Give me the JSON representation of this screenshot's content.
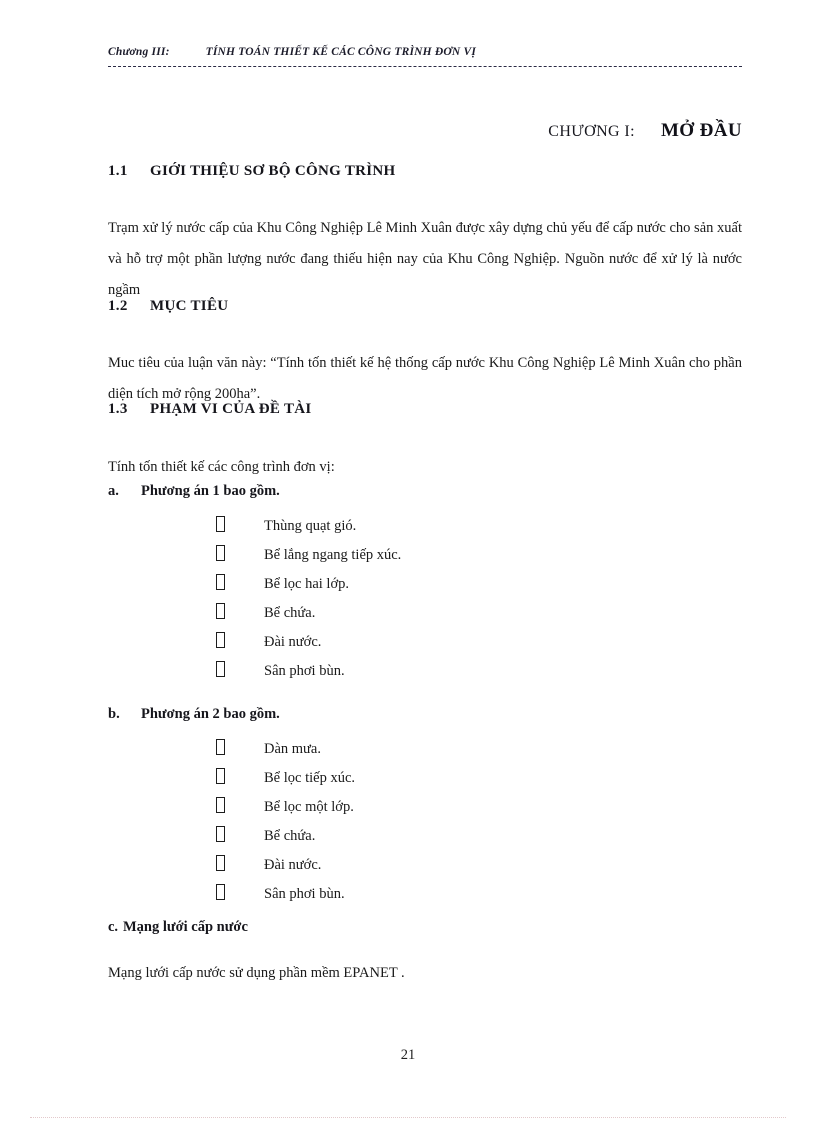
{
  "running_header": {
    "chapter_label": "Chương III:",
    "title": "TÍNH TOÁN THIẾT KẾ CÁC CÔNG TRÌNH ĐƠN VỊ"
  },
  "chapter_title": {
    "label": "CHƯƠNG I:",
    "name": "MỞ ĐẦU"
  },
  "sections": {
    "s1": {
      "number": "1.1",
      "heading": "GIỚI THIỆU SƠ BỘ CÔNG TRÌNH",
      "body": "Trạm xử lý nước cấp của Khu Công Nghiệp Lê Minh Xuân được xây dựng chủ yếu để cấp nước cho sản xuất và hỗ trợ một phần lượng nước đang thiếu hiện nay của Khu Công Nghiệp. Nguồn nước để xử lý là nước ngầm"
    },
    "s2": {
      "number": "1.2",
      "heading": "MỤC TIÊU",
      "body": "Muc tiêu của luận văn này: “Tính tốn thiết kế hệ thống cấp nước Khu Công Nghiệp Lê Minh Xuân cho phần diện tích mở rộng 200ha”."
    },
    "s3": {
      "number": "1.3",
      "heading": "PHẠM VI CỦA ĐỀ TÀI",
      "intro": "Tính tốn thiết kế các công trình đơn vị:",
      "item_a": {
        "marker": "a.",
        "text": "Phương án 1 bao gồm.",
        "bullets": [
          "Thùng  quạt gió.",
          "Bể lắng ngang  tiếp xúc.",
          "Bể lọc hai lớp.",
          "Bể chứa.",
          "Đài nước.",
          "Sân phơi  bùn."
        ]
      },
      "item_b": {
        "marker": "b.",
        "text": "Phương án 2 bao gồm.",
        "bullets": [
          "Dàn mưa.",
          "Bể lọc tiếp xúc.",
          "Bể lọc một lớp.",
          "Bể chứa.",
          "Đài nước.",
          "Sân phơi  bùn."
        ]
      },
      "item_c": {
        "marker": "c.",
        "text": "Mạng lưới cấp nước",
        "body": "Mạng lưới cấp nước sử dụng phần mềm EPANET ."
      }
    }
  },
  "footer": {
    "page_number": "21"
  },
  "icons": {
    "bullet": "missing-glyph-box"
  },
  "colors": {
    "text": "#1a1a1a",
    "header_rule": "#2b2b45",
    "footer_rule": "#e3c9cc"
  }
}
